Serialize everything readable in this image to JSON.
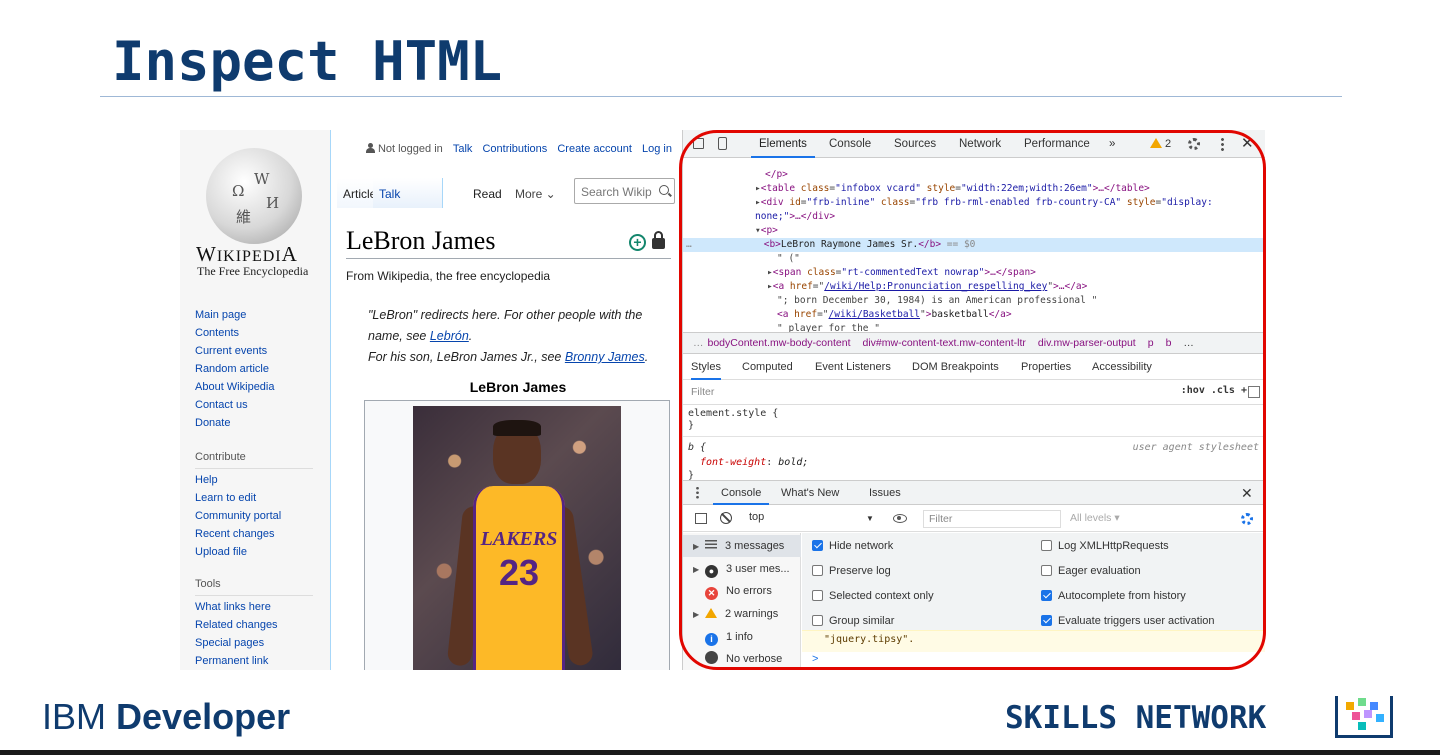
{
  "slide": {
    "title": "Inspect HTML",
    "brand_left_light": "IBM",
    "brand_left_bold": "Developer",
    "brand_right": "SKILLS NETWORK"
  },
  "wikipedia": {
    "logo_text": "Wikipedia",
    "tagline": "The Free Encyclopedia",
    "nav_main": [
      "Main page",
      "Contents",
      "Current events",
      "Random article",
      "About Wikipedia",
      "Contact us",
      "Donate"
    ],
    "nav_contribute_head": "Contribute",
    "nav_contribute": [
      "Help",
      "Learn to edit",
      "Community portal",
      "Recent changes",
      "Upload file"
    ],
    "nav_tools_head": "Tools",
    "nav_tools": [
      "What links here",
      "Related changes",
      "Special pages",
      "Permanent link"
    ],
    "user_status": "Not logged in",
    "user_links": [
      "Talk",
      "Contributions",
      "Create account",
      "Log in"
    ],
    "tabs": {
      "article": "Article",
      "talk": "Talk",
      "read": "Read",
      "more": "More ⌄"
    },
    "search_placeholder": "Search Wikip",
    "heading": "LeBron James",
    "from_line": "From Wikipedia, the free encyclopedia",
    "hatnote_1": "\"LeBron\" redirects here. For other people with the name, see",
    "hatnote_1_link": "Lebrón",
    "hatnote_2": "For his son, LeBron James Jr., see",
    "hatnote_2_link": "Bronny James",
    "infobox_title": "LeBron James",
    "photo_jersey_text": "LAKERS",
    "photo_jersey_number": "23"
  },
  "devtools": {
    "tabs": [
      "Elements",
      "Console",
      "Sources",
      "Network",
      "Performance"
    ],
    "more_tabs": "»",
    "warning_count": "2",
    "code": {
      "l1": "</p>",
      "l2_tag_open": "<table ",
      "l2_attr1": "class",
      "l2_val1": "\"infobox vcard\"",
      "l2_attr2": "style",
      "l2_val2": "\"width:22em;width:26em\"",
      "l2_tail": ">…</table>",
      "l3_tag_open": "<div ",
      "l3_attr1": "id",
      "l3_val1": "\"frb-inline\"",
      "l3_attr2": "class",
      "l3_val2": "\"frb frb-rml-enabled frb-country-CA\"",
      "l3_attr3": "style",
      "l3_val3": "\"display:",
      "l4_val": "none;\"",
      "l4_tail": ">…</div>",
      "l5": "<p>",
      "l6_open": "<b>",
      "l6_text": "LeBron Raymone James Sr.",
      "l6_close": "</b>",
      "l6_suffix": " == $0",
      "l7": "\" (\"",
      "l8_tag": "<span ",
      "l8_attr": "class",
      "l8_val": "\"rt-commentedText nowrap\"",
      "l8_tail": ">…</span>",
      "l9_tag": "<a ",
      "l9_attr": "href",
      "l9_val": "/wiki/Help:Pronunciation_respelling_key",
      "l9_tail": ">…</a>",
      "l10": "\"; born December 30, 1984) is an American professional \"",
      "l11_tag": "<a ",
      "l11_attr": "href",
      "l11_val": "/wiki/Basketball",
      "l11_text": "basketball",
      "l11_close": "</a>",
      "l12": "\" player for the \""
    },
    "breadcrumbs": [
      "bodyContent.mw-body-content",
      "div#mw-content-text.mw-content-ltr",
      "div.mw-parser-output",
      "p",
      "b"
    ],
    "breadcrumbs_leading": "…",
    "breadcrumbs_more": "…",
    "style_tabs": [
      "Styles",
      "Computed",
      "Event Listeners",
      "DOM Breakpoints",
      "Properties",
      "Accessibility"
    ],
    "filter_placeholder": "Filter",
    "filter_tools": ":hov  .cls  +",
    "rule1_selector": "element.style {",
    "rule1_close": "}",
    "rule2_selector": "b {",
    "rule2_source": "user agent stylesheet",
    "rule2_prop": "font-weight",
    "rule2_val": "bold;",
    "rule2_close": "}",
    "drawer_tabs": [
      "Console",
      "What's New",
      "Issues"
    ],
    "context": "top",
    "console_filter_placeholder": "Filter",
    "levels": "All levels ▾",
    "message_groups": [
      {
        "label": "3 messages",
        "icon": "list-icon"
      },
      {
        "label": "3 user mes...",
        "icon": "user-icon"
      },
      {
        "label": "No errors",
        "icon": "error-icon"
      },
      {
        "label": "2 warnings",
        "icon": "warning-icon"
      },
      {
        "label": "1 info",
        "icon": "info-icon"
      },
      {
        "label": "No verbose",
        "icon": "verbose-icon"
      }
    ],
    "settings": [
      {
        "label": "Hide network",
        "checked": true
      },
      {
        "label": "Log XMLHttpRequests",
        "checked": false
      },
      {
        "label": "Preserve log",
        "checked": false
      },
      {
        "label": "Eager evaluation",
        "checked": false
      },
      {
        "label": "Selected context only",
        "checked": false
      },
      {
        "label": "Autocomplete from history",
        "checked": true
      },
      {
        "label": "Group similar",
        "checked": false
      },
      {
        "label": "Evaluate triggers user activation",
        "checked": true
      }
    ],
    "warning_text": "\"jquery.tipsy\".",
    "prompt": ">"
  },
  "colors": {
    "title_blue": "#0f3b6e",
    "highlight_red": "#e10600",
    "devtools_accent": "#1a73e8",
    "wiki_link": "#0645ad"
  }
}
